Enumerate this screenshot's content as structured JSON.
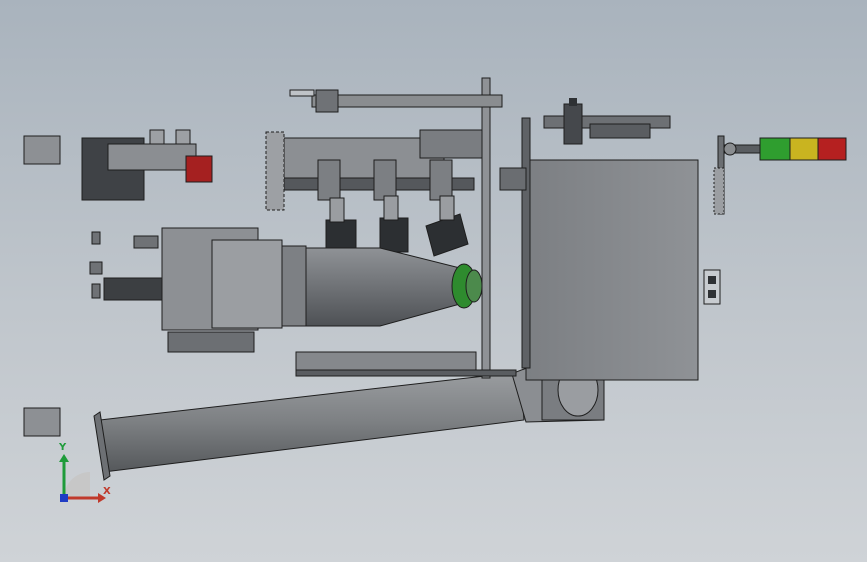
{
  "viewport": {
    "background_top": "#a9b3bd",
    "background_bottom": "#cfd3d7"
  },
  "triad": {
    "x_label": "X",
    "y_label": "Y",
    "x_color": "#c0392b",
    "y_color": "#1e9b3a",
    "z_color": "#1f3cc4"
  },
  "model": {
    "body_color": "#8a8d90",
    "dark_color": "#3a3d40",
    "edge_color": "#1e1e1e",
    "accent_green": "#2e8b2e",
    "accent_red": "#a52020",
    "tower_light_colors": [
      "#2f9e2f",
      "#c9b420",
      "#b52020"
    ]
  }
}
